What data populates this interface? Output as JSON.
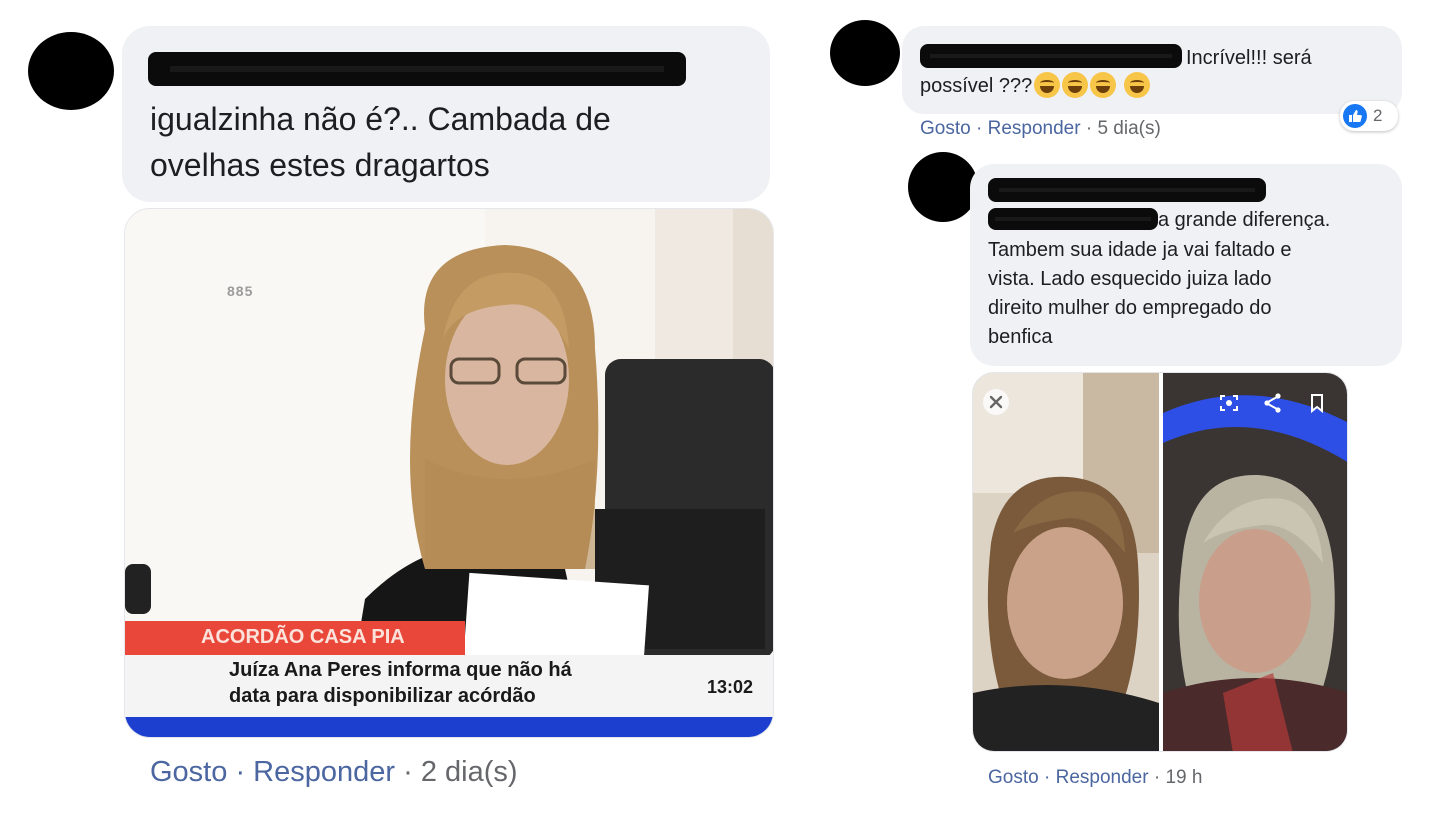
{
  "left_comment": {
    "text": "igualzinha não é?.. Cambada de ovelhas estes dragartos",
    "image": {
      "station_logo": "885",
      "banner_title": "ACORDÃO CASA PIA",
      "banner_line1": "Juíza Ana Peres informa que não há",
      "banner_line2": "data para disponibilizar acórdão",
      "clock": "13:02"
    },
    "actions": {
      "like": "Gosto",
      "sep1": "·",
      "reply": "Responder",
      "sep2": "·",
      "time": "2 dia(s)"
    }
  },
  "right_comment_1": {
    "text_line1": "Incrível!!! será",
    "text_line2": "possível ???",
    "reaction_count": "2",
    "actions": {
      "like": "Gosto",
      "sep1": "·",
      "reply": "Responder",
      "sep2": "·",
      "time": "5 dia(s)"
    }
  },
  "right_comment_2": {
    "text_line1": "a grande diferença.",
    "text_lines": [
      "Tambem sua idade ja vai faltado e",
      "vista. Lado esquecido juiza lado",
      "direito mulher do empregado do",
      "benfica"
    ],
    "actions": {
      "like": "Gosto",
      "sep1": "·",
      "reply": "Responder",
      "sep2": "·",
      "time": "19 h"
    }
  },
  "colors": {
    "bubble": "#eff1f4",
    "link": "#4b66a0",
    "like_blue": "#1877f2",
    "banner_red": "#e8473a",
    "banner_blue": "#1c3fd0"
  }
}
